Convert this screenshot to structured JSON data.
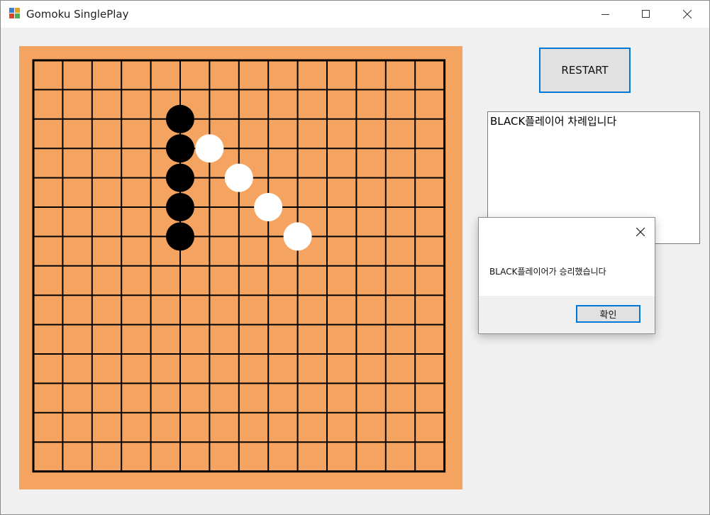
{
  "window": {
    "title": "Gomoku SinglePlay",
    "icon": "gomoku-app-icon",
    "controls": [
      "minimize-icon",
      "maximize-icon",
      "close-icon"
    ]
  },
  "board": {
    "background_color": "#f4a460",
    "line_color": "#000000",
    "cells": 14,
    "black_stones": [
      [
        5,
        2
      ],
      [
        5,
        3
      ],
      [
        5,
        4
      ],
      [
        5,
        5
      ],
      [
        5,
        6
      ]
    ],
    "white_stones": [
      [
        6,
        3
      ],
      [
        7,
        4
      ],
      [
        8,
        5
      ],
      [
        9,
        6
      ]
    ]
  },
  "controls": {
    "restart_label": "RESTART"
  },
  "status": {
    "text": "BLACK플레이어 차례입니다"
  },
  "dialog": {
    "message": "BLACK플레이어가 승리했습니다",
    "ok_label": "확인",
    "accent_color": "#0078d7"
  }
}
